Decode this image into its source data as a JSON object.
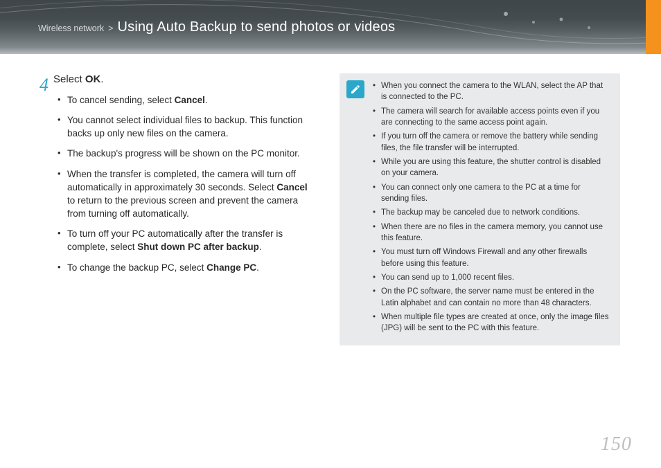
{
  "header": {
    "breadcrumb_section": "Wireless network",
    "breadcrumb_sep": ">",
    "title": "Using Auto Backup to send photos or videos"
  },
  "step": {
    "number": "4",
    "line_pre": "Select ",
    "line_bold": "OK",
    "line_post": "."
  },
  "bullets": {
    "b1_pre": "To cancel sending, select ",
    "b1_bold": "Cancel",
    "b1_post": ".",
    "b2": "You cannot select individual files to backup. This function backs up only new files on the camera.",
    "b3": "The backup's progress will be shown on the PC monitor.",
    "b4_pre": "When the transfer is completed, the camera will turn off automatically in approximately 30 seconds. Select ",
    "b4_bold": "Cancel",
    "b4_post": " to return to the previous screen and prevent the camera from turning off automatically.",
    "b5_pre": "To turn off your PC automatically after the transfer is complete, select ",
    "b5_bold": "Shut down PC after backup",
    "b5_post": ".",
    "b6_pre": "To change the backup PC, select ",
    "b6_bold": "Change PC",
    "b6_post": "."
  },
  "notes": {
    "n1": "When you connect the camera to the WLAN, select the AP that is connected to the PC.",
    "n2": "The camera will search for available access points even if you are connecting to the same access point again.",
    "n3": "If you turn off the camera or remove the battery while sending files, the file transfer will be interrupted.",
    "n4": "While you are using this feature, the shutter control is disabled on your camera.",
    "n5": "You can connect only one camera to the PC at a time for sending files.",
    "n6": "The backup may be canceled due to network conditions.",
    "n7": "When there are no files in the camera memory, you cannot use this feature.",
    "n8": "You must turn off Windows Firewall and any other firewalls before using this feature.",
    "n9": "You can send up to 1,000 recent files.",
    "n10": "On the PC software, the server name must be entered in the Latin alphabet and can contain no more than 48 characters.",
    "n11": "When multiple file types are created at once, only the image files (JPG) will be sent to the PC with this feature."
  },
  "page_number": "150"
}
